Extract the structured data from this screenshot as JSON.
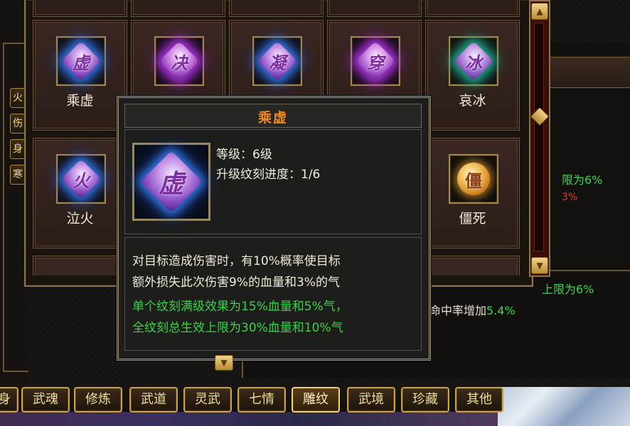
{
  "grid": {
    "cells": [
      {
        "name": "乘虚",
        "glyph": "虚",
        "color": "blue"
      },
      {
        "name": "",
        "glyph": "决",
        "color": "purple"
      },
      {
        "name": "",
        "glyph": "凝",
        "color": "blue"
      },
      {
        "name": "",
        "glyph": "穿",
        "color": "purple"
      },
      {
        "name": "哀冰",
        "glyph": "冰",
        "color": "green"
      },
      {
        "name": "泣火",
        "glyph": "火",
        "color": "blue"
      },
      {
        "name": "僵死",
        "glyph": "僵",
        "color": "gold"
      }
    ]
  },
  "side_tabs": [
    "火",
    "伤",
    "身",
    "寒"
  ],
  "right_texts": {
    "line1": "限为6%",
    "line2": "3%",
    "line3": "上限为6%",
    "line4_prefix": "命中率增加",
    "line4_value": "5.4%"
  },
  "tooltip": {
    "title": "乘虚",
    "glyph": "虚",
    "level": "等级：6级",
    "progress": "升级纹刻进度：1/6",
    "desc": [
      {
        "text": "对目标造成伤害时，有10%概率使目标",
        "color": "white"
      },
      {
        "text": "额外损失此次伤害9%的血量和3%的气",
        "color": "white"
      },
      {
        "text": "单个纹刻满级效果为15%血量和5%气，",
        "color": "green"
      },
      {
        "text": "全纹刻总生效上限为30%血量和10%气",
        "color": "green"
      }
    ]
  },
  "tabs": [
    {
      "label": "身",
      "active": false
    },
    {
      "label": "武魂",
      "active": false
    },
    {
      "label": "修炼",
      "active": false
    },
    {
      "label": "武道",
      "active": false
    },
    {
      "label": "灵武",
      "active": false
    },
    {
      "label": "七情",
      "active": false
    },
    {
      "label": "雕纹",
      "active": true
    },
    {
      "label": "武境",
      "active": false
    },
    {
      "label": "珍藏",
      "active": false
    },
    {
      "label": "其他",
      "active": false
    }
  ]
}
